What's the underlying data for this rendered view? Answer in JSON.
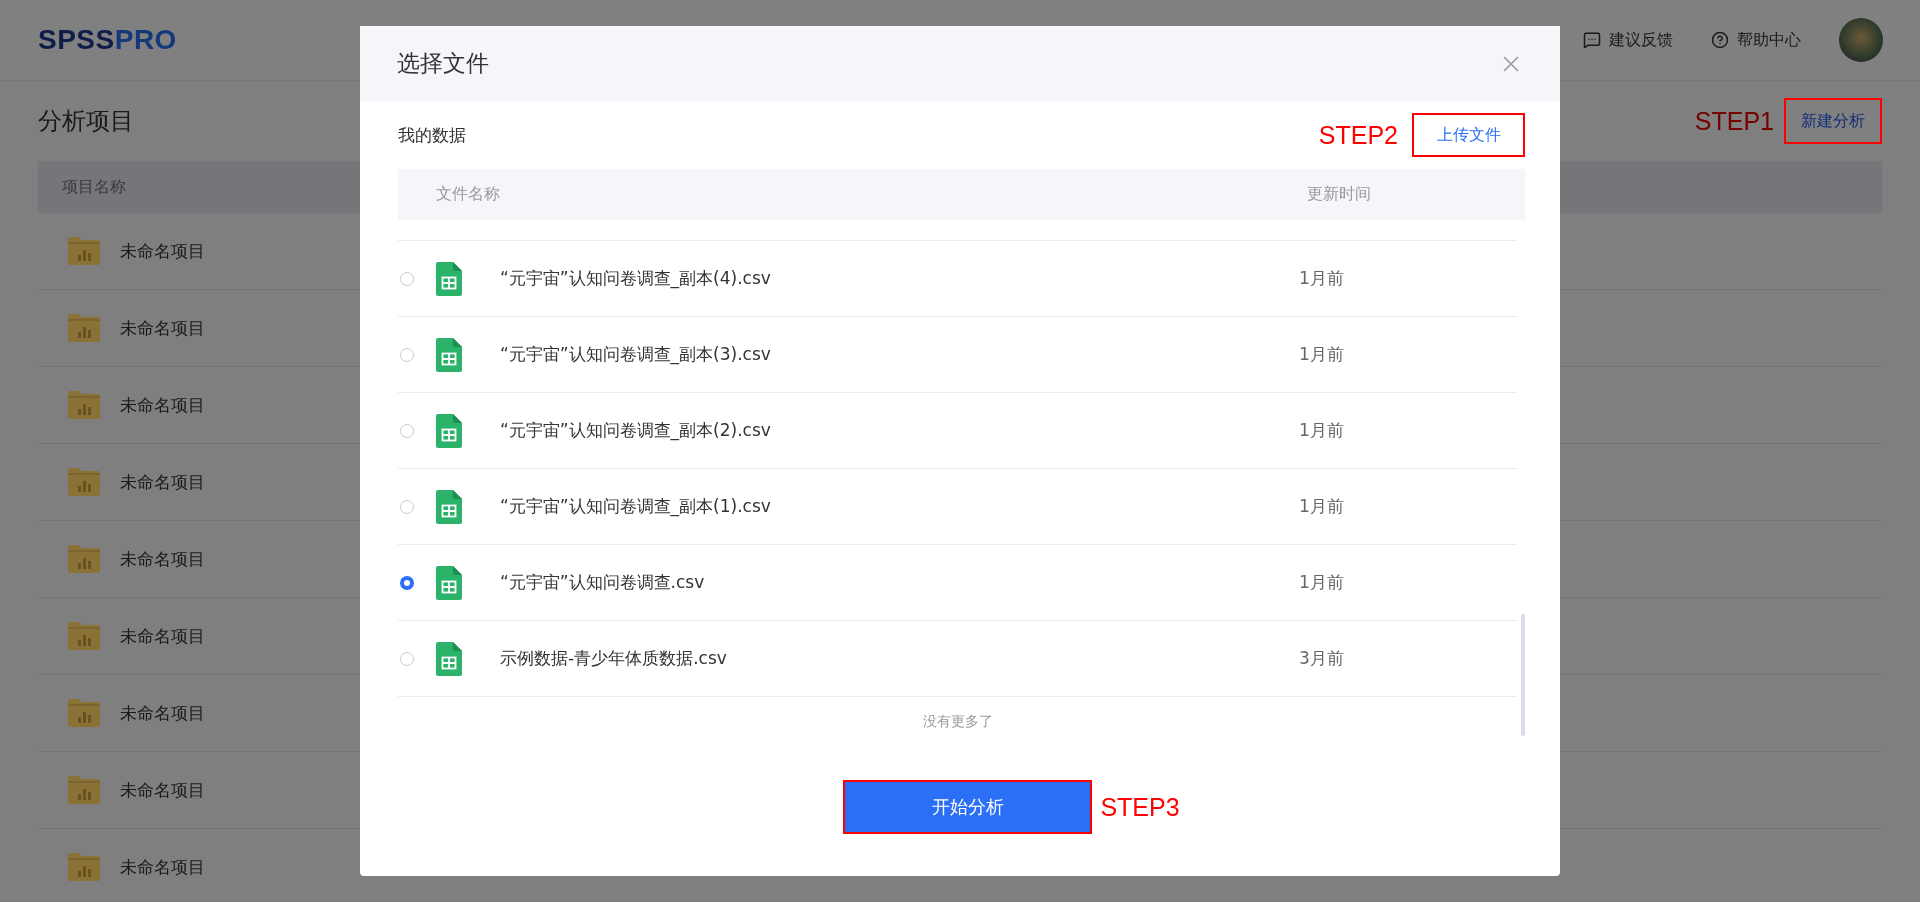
{
  "header": {
    "logo_main": "SPSS",
    "logo_accent": "PRO",
    "links": [
      {
        "kind": "feedback",
        "label": "建议反馈"
      },
      {
        "kind": "help",
        "label": "帮助中心"
      }
    ]
  },
  "page": {
    "title": "分析项目",
    "step_label": "STEP1",
    "new_button": "新建分析",
    "columns": [
      "项目名称"
    ],
    "rows": [
      "未命名项目",
      "未命名项目",
      "未命名项目",
      "未命名项目",
      "未命名项目",
      "未命名项目",
      "未命名项目",
      "未命名项目",
      "未命名项目"
    ]
  },
  "modal": {
    "title": "选择文件",
    "section_title": "我的数据",
    "step_label": "STEP2",
    "upload_button": "上传文件",
    "columns": [
      "文件名称",
      "更新时间"
    ],
    "files": [
      {
        "name": "“元宇宙”认知问卷调查_副本(4).csv",
        "updated": "1月前",
        "selected": false
      },
      {
        "name": "“元宇宙”认知问卷调查_副本(3).csv",
        "updated": "1月前",
        "selected": false
      },
      {
        "name": "“元宇宙”认知问卷调查_副本(2).csv",
        "updated": "1月前",
        "selected": false
      },
      {
        "name": "“元宇宙”认知问卷调查_副本(1).csv",
        "updated": "1月前",
        "selected": false
      },
      {
        "name": "“元宇宙”认知问卷调查.csv",
        "updated": "1月前",
        "selected": true
      },
      {
        "name": "示例数据-青少年体质数据.csv",
        "updated": "3月前",
        "selected": false
      }
    ],
    "end_note": "没有更多了",
    "submit_button": "开始分析",
    "submit_step": "STEP3"
  }
}
